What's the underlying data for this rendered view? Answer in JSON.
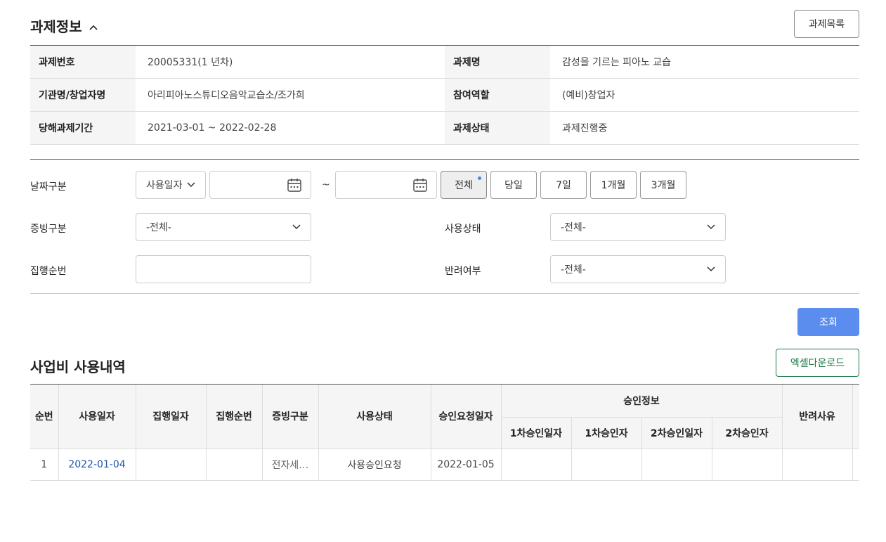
{
  "header": {
    "title": "과제정보",
    "list_button": "과제목록"
  },
  "info": {
    "rows": [
      {
        "l1": "과제번호",
        "v1": "20005331(1 년차)",
        "l2": "과제명",
        "v2": "감성을 기르는 피아노 교습"
      },
      {
        "l1": "기관명/창업자명",
        "v1": "아리피아노스튜디오음악교습소/조가희",
        "l2": "참여역할",
        "v2": "(예비)창업자"
      },
      {
        "l1": "당해과제기간",
        "v1": "2021-03-01 ~ 2022-02-28",
        "l2": "과제상태",
        "v2": "과제진행중"
      }
    ]
  },
  "search": {
    "date_label": "날짜구분",
    "date_type": "사용일자",
    "date_from": "",
    "date_to": "",
    "tilde": "~",
    "periods": [
      "전체",
      "당일",
      "7일",
      "1개월",
      "3개월"
    ],
    "evidence_label": "증빙구분",
    "evidence_value": "-전체-",
    "status_label": "사용상태",
    "status_value": "-전체-",
    "exec_label": "집행순번",
    "exec_value": "",
    "reject_label": "반려여부",
    "reject_value": "-전체-",
    "search_button": "조회"
  },
  "usage": {
    "title": "사업비 사용내역",
    "excel_button": "엑셀다운로드",
    "headers": {
      "no": "순번",
      "use_date": "사용일자",
      "exec_date": "집행일자",
      "exec_no": "집행순번",
      "evidence": "증빙구분",
      "status": "사용상태",
      "req_date": "승인요청일자",
      "approval": "승인정보",
      "a1_date": "1차승인일자",
      "a1_person": "1차승인자",
      "a2_date": "2차승인일자",
      "a2_person": "2차승인자",
      "reject_reason": "반려사유"
    },
    "rows": [
      {
        "no": "1",
        "use_date": "2022-01-04",
        "exec_date": "",
        "exec_no": "",
        "evidence": "전자세…",
        "status": "사용승인요청",
        "req_date": "2022-01-05",
        "a1_date": "",
        "a1_person": "",
        "a2_date": "",
        "a2_person": "",
        "reject_reason": ""
      }
    ]
  },
  "colors": {
    "accent": "#5b8def",
    "excel": "#1d7a45",
    "link": "#2255aa"
  }
}
